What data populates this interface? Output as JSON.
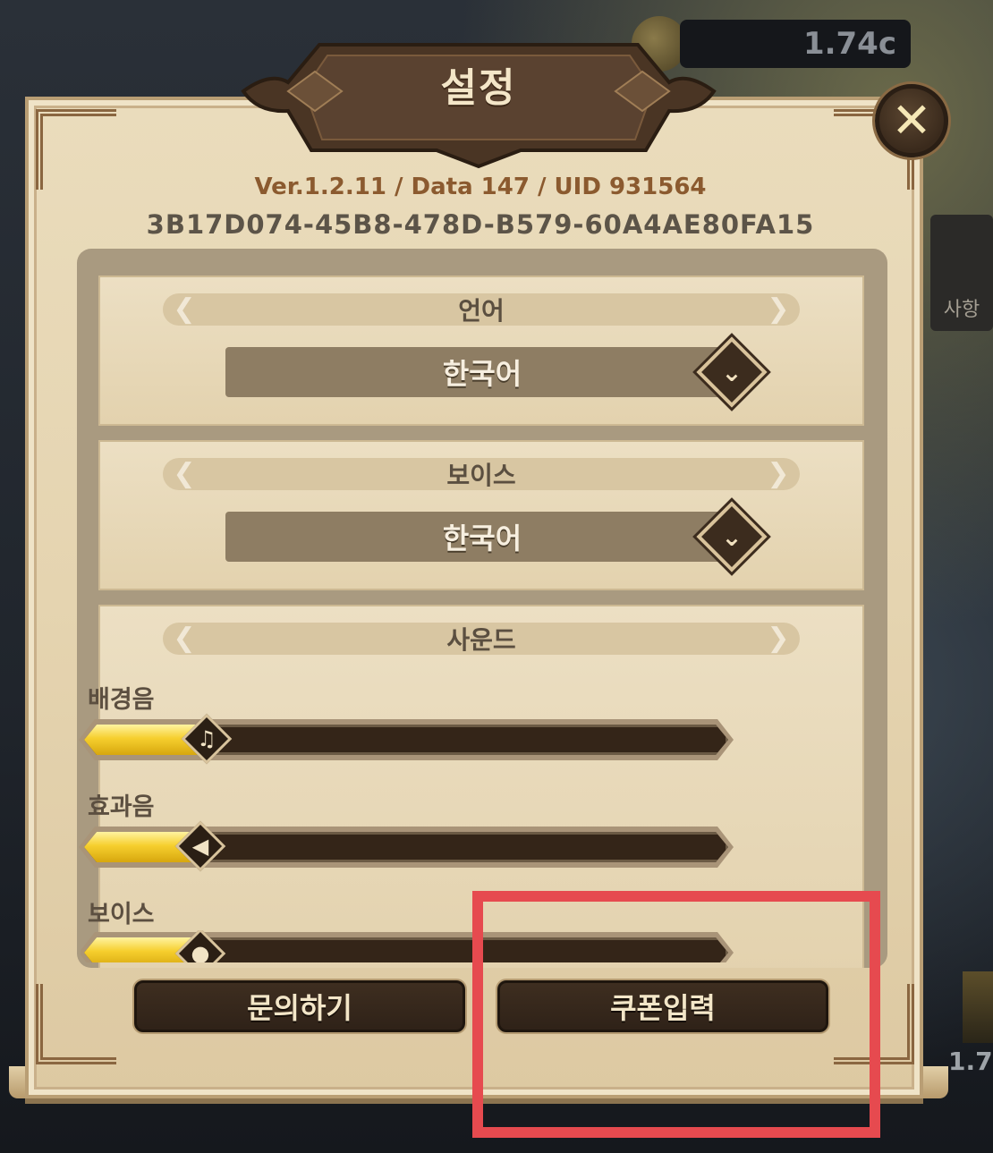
{
  "background": {
    "currency_value": "1.74c",
    "side_notice_label": "사항",
    "side_value": "1.7"
  },
  "dialog": {
    "title": "설정",
    "close_symbol": "✕",
    "version_line": "Ver.1.2.11 / Data 147 / UID 931564",
    "device_id": "3B17D074-45B8-478D-B579-60A4AE80FA15"
  },
  "language": {
    "header": "언어",
    "selected": "한국어"
  },
  "voice_language": {
    "header": "보이스",
    "selected": "한국어"
  },
  "sound": {
    "header": "사운드",
    "sliders": [
      {
        "label": "배경음",
        "icon": "music-note-icon",
        "level": 0.19
      },
      {
        "label": "효과음",
        "icon": "speaker-icon",
        "level": 0.18
      },
      {
        "label": "보이스",
        "icon": "microphone-icon",
        "level": 0.18
      }
    ]
  },
  "buttons": {
    "inquiry": "문의하기",
    "coupon": "쿠폰입력"
  },
  "colors": {
    "panel": "#e5d4b0",
    "button": "#3e2e20",
    "slider_fill": "#f6cf2e",
    "highlight": "#e64a4f"
  }
}
